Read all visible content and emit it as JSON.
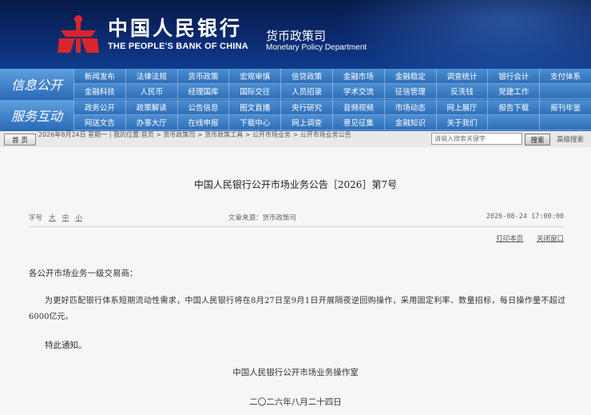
{
  "header": {
    "bank_name_cn": "中国人民银行",
    "bank_name_en": "THE PEOPLE'S BANK OF CHINA",
    "dept_cn": "货币政策司",
    "dept_en": "Monetary Policy Department",
    "logo_color": "#d8262c"
  },
  "nav": {
    "info": {
      "label": "信息公开",
      "row1": [
        "新闻发布",
        "法律法规",
        "货币政策",
        "宏观审慎",
        "信贷政策",
        "金融市场",
        "金融稳定",
        "调查统计",
        "银行会计",
        "支付体系"
      ],
      "row2": [
        "金融科技",
        "人民币",
        "经理国库",
        "国际交往",
        "人员招录",
        "学术交流",
        "征信管理",
        "反洗钱",
        "党建工作",
        ""
      ]
    },
    "service": {
      "label": "服务互动",
      "row1": [
        "政务公开",
        "政策解读",
        "公告信息",
        "图文直播",
        "央行研究",
        "音频视频",
        "市场动态",
        "网上展厅",
        "报告下载",
        "报刊年鉴"
      ],
      "row2": [
        "网送文告",
        "办事大厅",
        "在线申报",
        "下载中心",
        "网上调查",
        "意见征集",
        "金融知识",
        "关于我们",
        "",
        ""
      ]
    }
  },
  "crumbbar": {
    "home_button": "首 页",
    "breadcrumb": "2026年8月24日 星期一 | 我的位置:首页 > 货币政策司 > 货币政策工具 > 公开市场业务 > 公开市场业务公告",
    "search_placeholder": "请输入搜索关键字",
    "search_button": "搜索",
    "advanced_search": "高级搜索"
  },
  "article": {
    "title": "中国人民银行公开市场业务公告［2026］第7号",
    "font_size_label": "字号",
    "font_large": "大",
    "font_medium": "中",
    "font_small": "小",
    "source": "文章来源：货币政策司",
    "datetime": "2026-08-24 17:00:00",
    "print_link": "打印本页",
    "close_link": "关闭窗口",
    "salutation": "各公开市场业务一级交易商：",
    "body": "为更好匹配银行体系短期流动性需求，中国人民银行将在8月27日至9月1日开展隔夜逆回购操作，采用固定利率、数量招标，每日操作量不超过6000亿元。",
    "notice": "特此通知。",
    "signature": "中国人民银行公开市场业务操作室",
    "sign_date": "二〇二六年八月二十四日"
  }
}
